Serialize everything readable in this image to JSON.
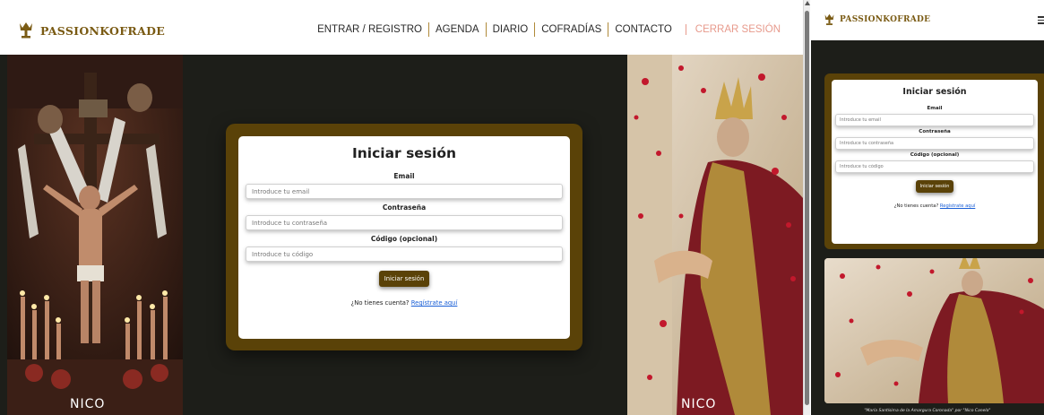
{
  "brand": {
    "name": "PASSIONKOFRADE",
    "color": "#7a5b14"
  },
  "nav": {
    "items": [
      "ENTRAR / REGISTRO",
      "AGENDA",
      "DIARIO",
      "COFRADÍAS",
      "CONTACTO"
    ],
    "logout": "CERRAR SESIÓN"
  },
  "login": {
    "title": "Iniciar sesión",
    "email_label": "Email",
    "email_placeholder": "Introduce tu email",
    "password_label": "Contraseña",
    "password_placeholder": "Introduce tu contraseña",
    "code_label": "Código (opcional)",
    "code_placeholder": "Introduce tu código",
    "submit_label": "Iniciar sesión",
    "no_account_text": "¿No tienes cuenta?",
    "register_link": "Regístrate aquí"
  },
  "photos": {
    "signature": "NICO",
    "caption": "\"María Santísima de la Amargura Coronada\" por \"Nico Canela\""
  },
  "colors": {
    "accent": "#5a4208",
    "background": "#1d1e19",
    "logout": "#e79a8c",
    "link": "#1a5fd6"
  },
  "icons": {
    "logo": "crown-chalice-icon",
    "menu": "hamburger-menu-icon"
  }
}
